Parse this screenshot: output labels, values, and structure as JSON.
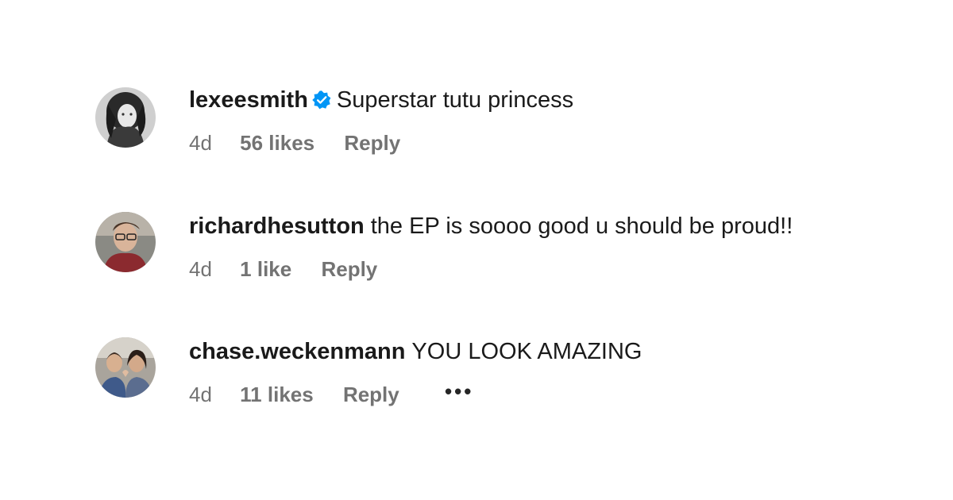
{
  "comments": [
    {
      "username": "lexeesmith",
      "verified": true,
      "text": "Superstar tutu princess",
      "time": "4d",
      "likes": "56 likes",
      "reply": "Reply",
      "avatar_icon": "user-avatar-photo"
    },
    {
      "username": "richardhesutton",
      "verified": false,
      "text": "the EP is soooo good u should be proud!!",
      "time": "4d",
      "likes": "1 like",
      "reply": "Reply",
      "avatar_icon": "user-avatar-photo"
    },
    {
      "username": "chase.weckenmann",
      "verified": false,
      "text": "YOU LOOK AMAZING",
      "time": "4d",
      "likes": "11 likes",
      "reply": "Reply",
      "more": "•••",
      "avatar_icon": "user-avatar-photo"
    }
  ],
  "colors": {
    "verified_blue": "#0095f6",
    "meta_gray": "#737373",
    "text": "#1a1a1a"
  }
}
